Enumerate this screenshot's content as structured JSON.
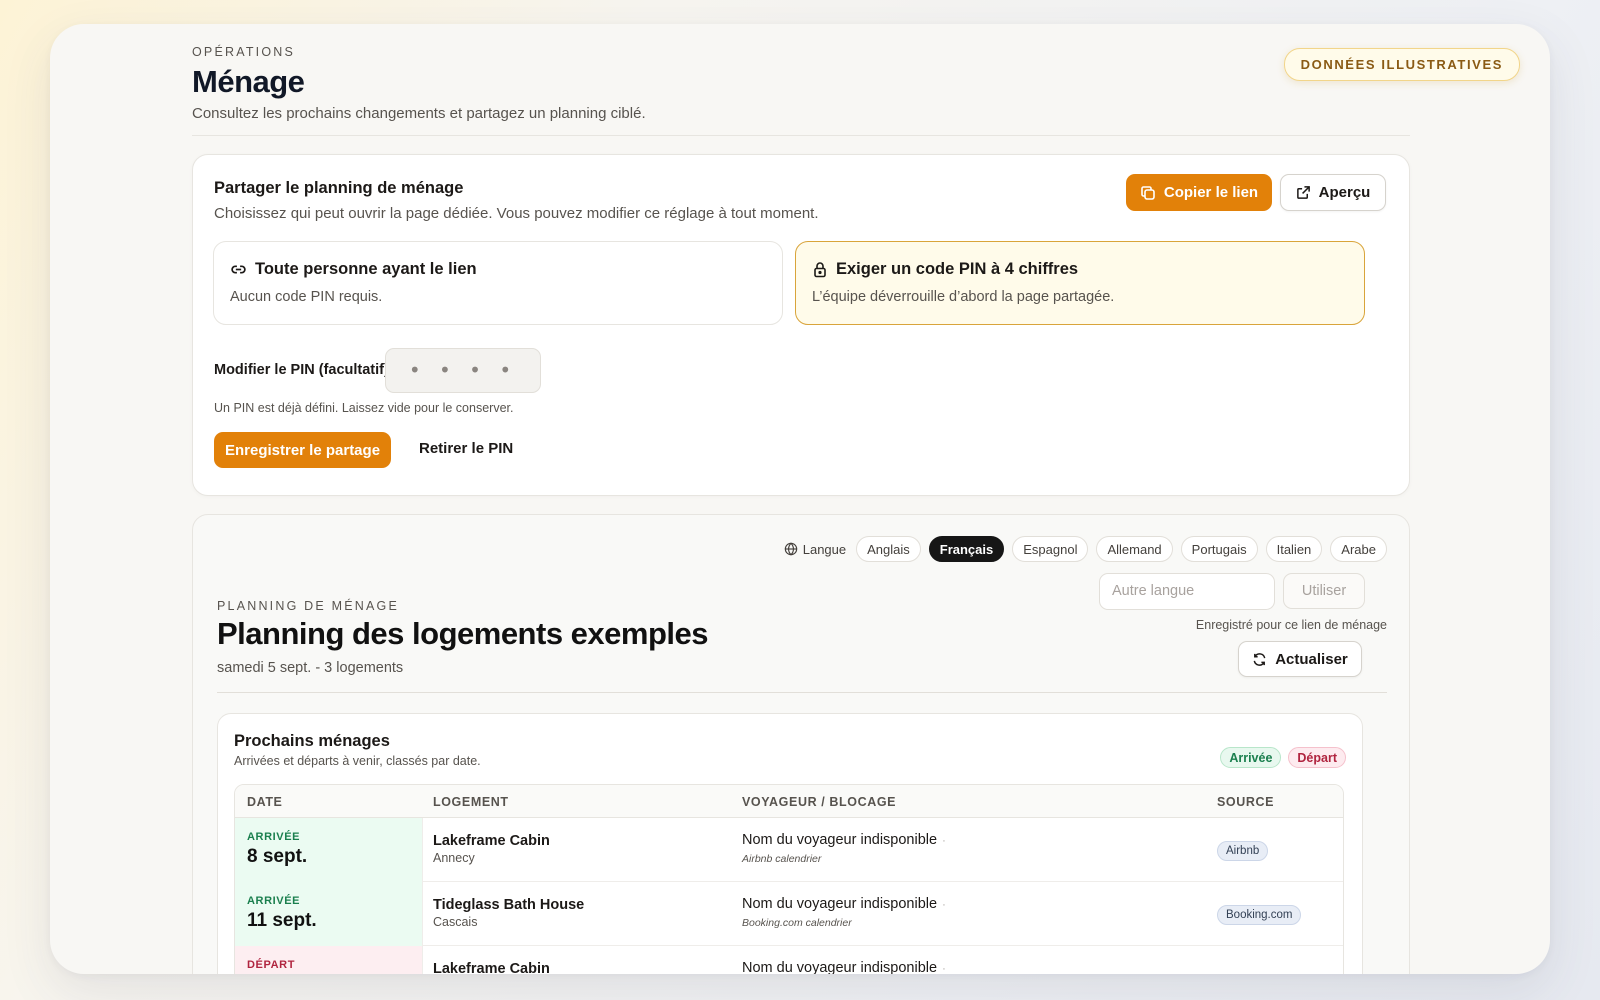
{
  "badge": "DONNÉES ILLUSTRATIVES",
  "header": {
    "eyebrow": "OPÉRATIONS",
    "title": "Ménage",
    "subtitle": "Consultez les prochains changements et partagez un planning ciblé."
  },
  "share": {
    "title": "Partager le planning de ménage",
    "subtitle": "Choisissez qui peut ouvrir la page dédiée. Vous pouvez modifier ce réglage à tout moment.",
    "copy_label": "Copier le lien",
    "preview_label": "Aperçu",
    "options": [
      {
        "title": "Toute personne ayant le lien",
        "desc": "Aucun code PIN requis.",
        "icon": "link-icon",
        "selected": false
      },
      {
        "title": "Exiger un code PIN à 4 chiffres",
        "desc": "L’équipe déverrouille d’abord la page partagée.",
        "icon": "lock-icon",
        "selected": true
      }
    ],
    "pin_label": "Modifier le PIN (facultatif)",
    "pin_placeholder": "• • • •",
    "pin_hint": "Un PIN est déjà défini. Laissez vide pour le conserver.",
    "save_label": "Enregistrer le partage",
    "remove_label": "Retirer le PIN"
  },
  "planning": {
    "language_label": "Langue",
    "languages": [
      {
        "label": "Anglais",
        "active": false
      },
      {
        "label": "Français",
        "active": true
      },
      {
        "label": "Espagnol",
        "active": false
      },
      {
        "label": "Allemand",
        "active": false
      },
      {
        "label": "Portugais",
        "active": false
      },
      {
        "label": "Italien",
        "active": false
      },
      {
        "label": "Arabe",
        "active": false
      }
    ],
    "other_lang_placeholder": "Autre langue",
    "use_label": "Utiliser",
    "saved_note": "Enregistré pour ce lien de ménage",
    "refresh_label": "Actualiser",
    "eyebrow": "PLANNING DE MÉNAGE",
    "title": "Planning des logements exemples",
    "subtitle": "samedi 5 sept. - 3 logements"
  },
  "upcoming": {
    "title": "Prochains ménages",
    "subtitle": "Arrivées et départs à venir, classés par date.",
    "legend_arrival": "Arrivée",
    "legend_departure": "Départ",
    "columns": [
      "DATE",
      "LOGEMENT",
      "VOYAGEUR / BLOCAGE",
      "SOURCE"
    ],
    "rows": [
      {
        "type": "arr",
        "event": "ARRIVÉE",
        "date": "8 sept.",
        "property": "Lakeframe Cabin",
        "city": "Annecy",
        "guest": "Nom du voyageur indisponible",
        "dot": "·",
        "guest_source": "Airbnb calendrier",
        "source": "Airbnb"
      },
      {
        "type": "arr",
        "event": "ARRIVÉE",
        "date": "11 sept.",
        "property": "Tideglass Bath House",
        "city": "Cascais",
        "guest": "Nom du voyageur indisponible",
        "dot": "·",
        "guest_source": "Booking.com calendrier",
        "source": "Booking.com"
      },
      {
        "type": "dep",
        "event": "DÉPART",
        "date": "",
        "property": "Lakeframe Cabin",
        "city": "",
        "guest": "Nom du voyageur indisponible",
        "dot": "·",
        "guest_source": "",
        "source": ""
      }
    ]
  },
  "colors": {
    "accent": "#e28109",
    "arrival": "#1a7f4e",
    "departure": "#b0243f"
  }
}
